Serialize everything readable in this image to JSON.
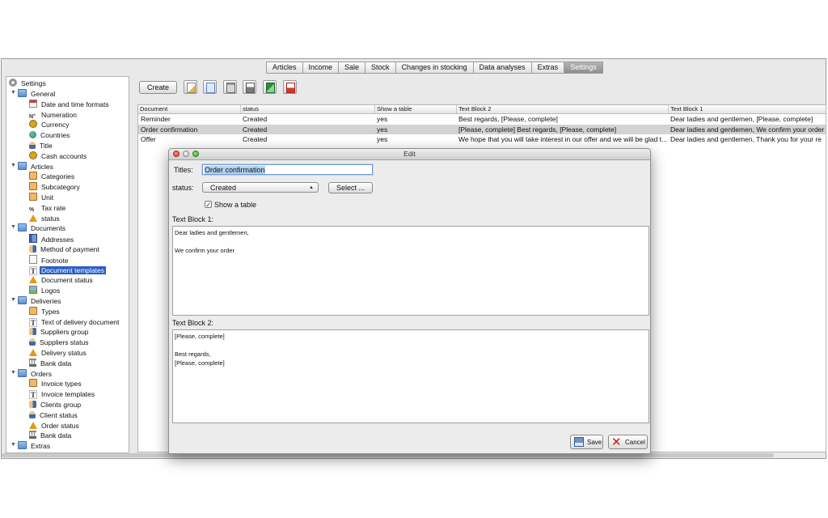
{
  "tabs": [
    {
      "label": "Articles",
      "active": false
    },
    {
      "label": "Income",
      "active": false
    },
    {
      "label": "Sale",
      "active": false
    },
    {
      "label": "Stock",
      "active": false
    },
    {
      "label": "Changes in stocking",
      "active": false
    },
    {
      "label": "Data analyses",
      "active": false
    },
    {
      "label": "Extras",
      "active": false
    },
    {
      "label": "Settings",
      "active": true
    }
  ],
  "tree": {
    "root": "Settings",
    "items": [
      {
        "label": "General",
        "kind": "folder",
        "icon": "folder-icon"
      },
      {
        "label": "Date and time formats",
        "kind": "leaf",
        "icon": "calendar-icon"
      },
      {
        "label": "Numeration",
        "kind": "leaf",
        "icon": "numeration-icon"
      },
      {
        "label": "Currency",
        "kind": "leaf",
        "icon": "currency-icon"
      },
      {
        "label": "Countries",
        "kind": "leaf",
        "icon": "globe-icon"
      },
      {
        "label": "Title",
        "kind": "leaf",
        "icon": "person-icon"
      },
      {
        "label": "Cash accounts",
        "kind": "leaf",
        "icon": "money-icon"
      },
      {
        "label": "Articles",
        "kind": "folder",
        "icon": "folder-icon"
      },
      {
        "label": "Categories",
        "kind": "leaf",
        "icon": "categories-icon"
      },
      {
        "label": "Subcategory",
        "kind": "leaf",
        "icon": "subcategory-icon"
      },
      {
        "label": "Unit",
        "kind": "leaf",
        "icon": "box-icon"
      },
      {
        "label": "Tax rate",
        "kind": "leaf",
        "icon": "percent-icon"
      },
      {
        "label": "status",
        "kind": "leaf",
        "icon": "warning-icon"
      },
      {
        "label": "Documents",
        "kind": "folder",
        "icon": "folder-icon"
      },
      {
        "label": "Addresses",
        "kind": "leaf",
        "icon": "address-book-icon"
      },
      {
        "label": "Method of payment",
        "kind": "leaf",
        "icon": "group-icon"
      },
      {
        "label": "Footnote",
        "kind": "leaf",
        "icon": "document-icon"
      },
      {
        "label": "Document templates",
        "kind": "leaf",
        "icon": "text-icon",
        "selected": true
      },
      {
        "label": "Document status",
        "kind": "leaf",
        "icon": "warning-icon"
      },
      {
        "label": "Logos",
        "kind": "leaf",
        "icon": "image-icon"
      },
      {
        "label": "Deliveries",
        "kind": "folder",
        "icon": "folder-icon"
      },
      {
        "label": "Types",
        "kind": "leaf",
        "icon": "box-icon"
      },
      {
        "label": "Text of delivery document",
        "kind": "leaf",
        "icon": "text-icon"
      },
      {
        "label": "Suppliers group",
        "kind": "leaf",
        "icon": "group-icon"
      },
      {
        "label": "Suppliers status",
        "kind": "leaf",
        "icon": "person-icon"
      },
      {
        "label": "Delivery status",
        "kind": "leaf",
        "icon": "warning-icon"
      },
      {
        "label": "Bank data",
        "kind": "leaf",
        "icon": "bank-icon"
      },
      {
        "label": "Orders",
        "kind": "folder",
        "icon": "folder-icon"
      },
      {
        "label": "Invoice types",
        "kind": "leaf",
        "icon": "box-icon"
      },
      {
        "label": "Invoice templates",
        "kind": "leaf",
        "icon": "text-icon"
      },
      {
        "label": "Clients group",
        "kind": "leaf",
        "icon": "group-icon"
      },
      {
        "label": "Client status",
        "kind": "leaf",
        "icon": "person-icon"
      },
      {
        "label": "Order status",
        "kind": "leaf",
        "icon": "warning-icon"
      },
      {
        "label": "Bank data",
        "kind": "leaf",
        "icon": "bank-icon"
      },
      {
        "label": "Extras",
        "kind": "folder",
        "icon": "folder-icon"
      }
    ]
  },
  "toolbar": {
    "create_label": "Create",
    "icons": [
      "new-document-icon",
      "copy-document-icon",
      "delete-icon",
      "print-icon",
      "export-excel-icon",
      "export-pdf-icon"
    ]
  },
  "table": {
    "headers": [
      "Document",
      "status",
      "Show a table",
      "Text Block 2",
      "Text Block 1"
    ],
    "rows": [
      [
        "Reminder",
        "Created",
        "yes",
        "Best regards, [Please, complete]",
        "Dear ladies and gentlemen,  [Please, complete]"
      ],
      [
        "Order confirmation",
        "Created",
        "yes",
        "[Please, complete]  Best regards, [Please, complete]",
        "Dear ladies and gentlemen,  We confirm your order"
      ],
      [
        "Offer",
        "Created",
        "yes",
        "We hope that you will take interest in our offer and we will be glad t...",
        "Dear ladies and gentlemen,  Thank you for your re"
      ]
    ],
    "selected_row": 1
  },
  "dialog": {
    "title": "Edit",
    "titles_label": "Titles:",
    "titles_value": "Order confirmation",
    "status_label": "status:",
    "status_value": "Created",
    "select_label": "Select ...",
    "show_table_label": "Show a table",
    "show_table_checked": true,
    "text_block1_label": "Text Block 1:",
    "text_block1_value": "Dear ladies and gentlemen,\n\nWe confirm your order",
    "text_block2_label": "Text Block 2:",
    "text_block2_value": "[Please, complete]\n\nBest regards,\n[Please, complete]",
    "save_label": "Save",
    "cancel_label": "Cancel"
  }
}
